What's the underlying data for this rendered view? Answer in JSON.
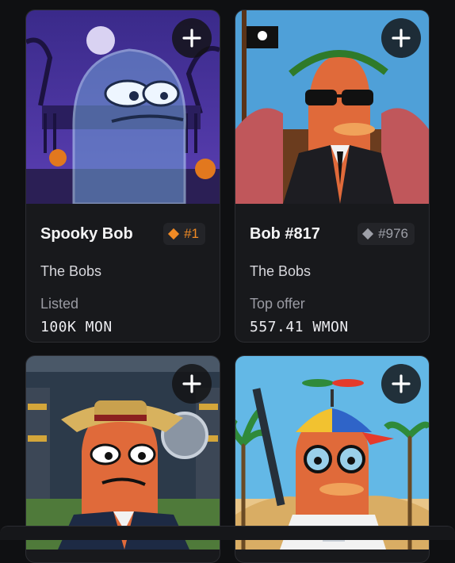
{
  "cards": [
    {
      "name": "Spooky Bob",
      "collection": "The Bobs",
      "rank": "#1",
      "rank_color": "#f08a24",
      "meta_label": "Listed",
      "meta_value": "100K MON",
      "art": "ghost-bob"
    },
    {
      "name": "Bob #817",
      "collection": "The Bobs",
      "rank": "#976",
      "rank_color": "#9ea0a8",
      "meta_label": "Top offer",
      "meta_value": "557.41 WMON",
      "art": "pirate-agent-bob"
    },
    {
      "name": "",
      "collection": "",
      "rank": "",
      "meta_label": "",
      "meta_value": "",
      "art": "captain-bob"
    },
    {
      "name": "",
      "collection": "",
      "rank": "",
      "meta_label": "",
      "meta_value": "",
      "art": "astronaut-bob"
    }
  ],
  "icons": {
    "add": "plus-icon",
    "rank": "diamond-icon"
  }
}
